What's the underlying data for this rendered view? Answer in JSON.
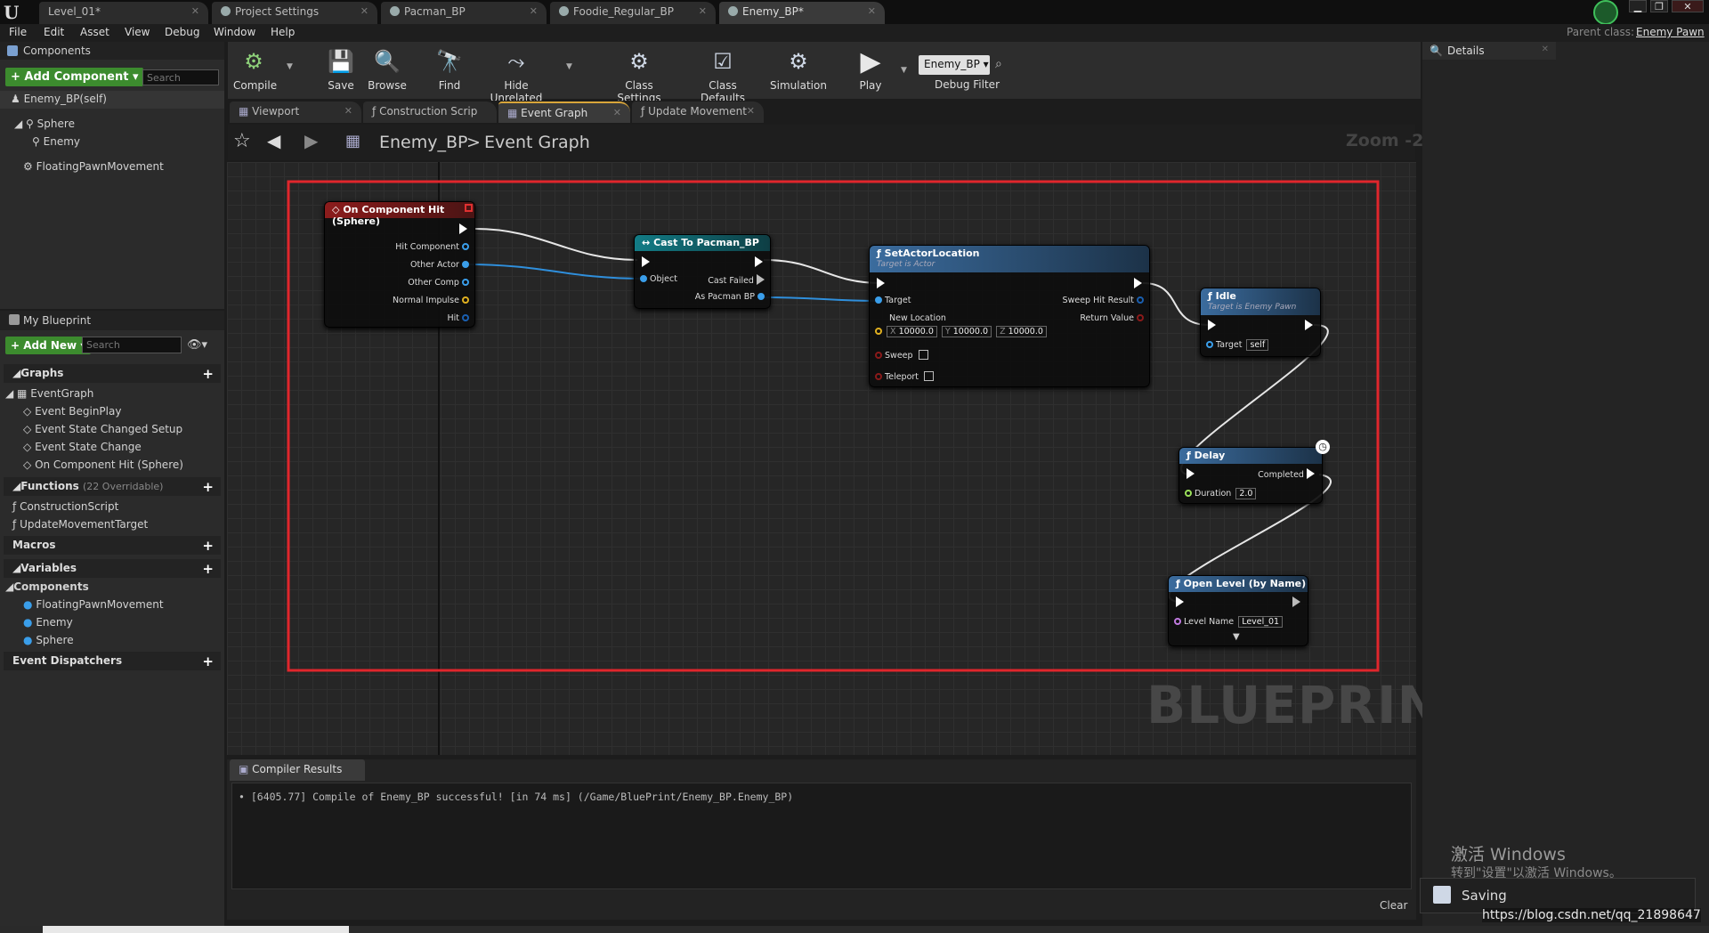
{
  "titlebar": {
    "tabs": [
      {
        "label": "Level_01*"
      },
      {
        "label": "Project Settings"
      },
      {
        "label": "Pacman_BP"
      },
      {
        "label": "Foodie_Regular_BP"
      },
      {
        "label": "Enemy_BP*"
      }
    ],
    "parent_class_label": "Parent class:",
    "parent_class_value": "Enemy Pawn"
  },
  "menu": [
    "File",
    "Edit",
    "Asset",
    "View",
    "Debug",
    "Window",
    "Help"
  ],
  "components_panel": {
    "title": "Components",
    "add_button": "+ Add Component ▾",
    "search_placeholder": "Search",
    "root": "Enemy_BP(self)",
    "tree": [
      "Sphere",
      "Enemy",
      "FloatingPawnMovement"
    ]
  },
  "my_blueprint": {
    "title": "My Blueprint",
    "add_button": "+ Add New ▾",
    "search_placeholder": "Search",
    "graphs_label": "Graphs",
    "eventgraph_label": "EventGraph",
    "events": [
      "Event BeginPlay",
      "Event State Changed Setup",
      "Event State Change",
      "On Component Hit (Sphere)"
    ],
    "functions_label": "Functions",
    "functions_overridable": "(22 Overridable)",
    "functions": [
      "ConstructionScript",
      "UpdateMovementTarget"
    ],
    "macros_label": "Macros",
    "variables_label": "Variables",
    "components_label": "Components",
    "components": [
      "FloatingPawnMovement",
      "Enemy",
      "Sphere"
    ],
    "dispatchers_label": "Event Dispatchers"
  },
  "toolbar": {
    "compile": "Compile",
    "save": "Save",
    "browse": "Browse",
    "find": "Find",
    "hide_unrelated": "Hide Unrelated",
    "class_settings": "Class Settings",
    "class_defaults": "Class Defaults",
    "simulation": "Simulation",
    "play": "Play",
    "debug_select": "Enemy_BP ▾",
    "debug_filter": "Debug Filter"
  },
  "editor_tabs": [
    "Viewport",
    "Construction Scrip",
    "Event Graph",
    "Update Movement"
  ],
  "graph": {
    "breadcrumb_blueprint": "Enemy_BP",
    "breadcrumb_sep": ">",
    "breadcrumb_graph": "Event Graph",
    "zoom": "Zoom -2",
    "watermark": "BLUEPRINT",
    "highlight_color": "#e0262c",
    "nodes": {
      "hit": {
        "title": "On Component Hit (Sphere)",
        "pins": [
          "Hit Component",
          "Other Actor",
          "Other Comp",
          "Normal Impulse",
          "Hit"
        ]
      },
      "cast": {
        "title": "Cast To Pacman_BP",
        "object": "Object",
        "cast_failed": "Cast Failed",
        "as_pacman": "As Pacman BP"
      },
      "setloc": {
        "title": "SetActorLocation",
        "subtitle": "Target is Actor",
        "target": "Target",
        "new_location": "New Location",
        "x_label": "X",
        "x": "10000.0",
        "y_label": "Y",
        "y": "10000.0",
        "z_label": "Z",
        "z": "10000.0",
        "sweep": "Sweep",
        "teleport": "Teleport",
        "sweep_hit": "Sweep Hit Result",
        "return_value": "Return Value"
      },
      "idle": {
        "title": "Idle",
        "subtitle": "Target is Enemy Pawn",
        "target": "Target",
        "self": "self"
      },
      "delay": {
        "title": "Delay",
        "completed": "Completed",
        "duration_label": "Duration",
        "duration": "2.0"
      },
      "openlevel": {
        "title": "Open Level (by Name)",
        "level_label": "Level Name",
        "level": "Level_01"
      }
    }
  },
  "details": {
    "title": "Details"
  },
  "compiler": {
    "tab": "Compiler Results",
    "message": "[6405.77] Compile of Enemy_BP successful! [in 74 ms] (/Game/BluePrint/Enemy_BP.Enemy_BP)",
    "clear": "Clear"
  },
  "overlay": {
    "activate_title": "激活 Windows",
    "activate_sub": "转到\"设置\"以激活 Windows。",
    "saving": "Saving",
    "url": "https://blog.csdn.net/qq_21898647"
  }
}
